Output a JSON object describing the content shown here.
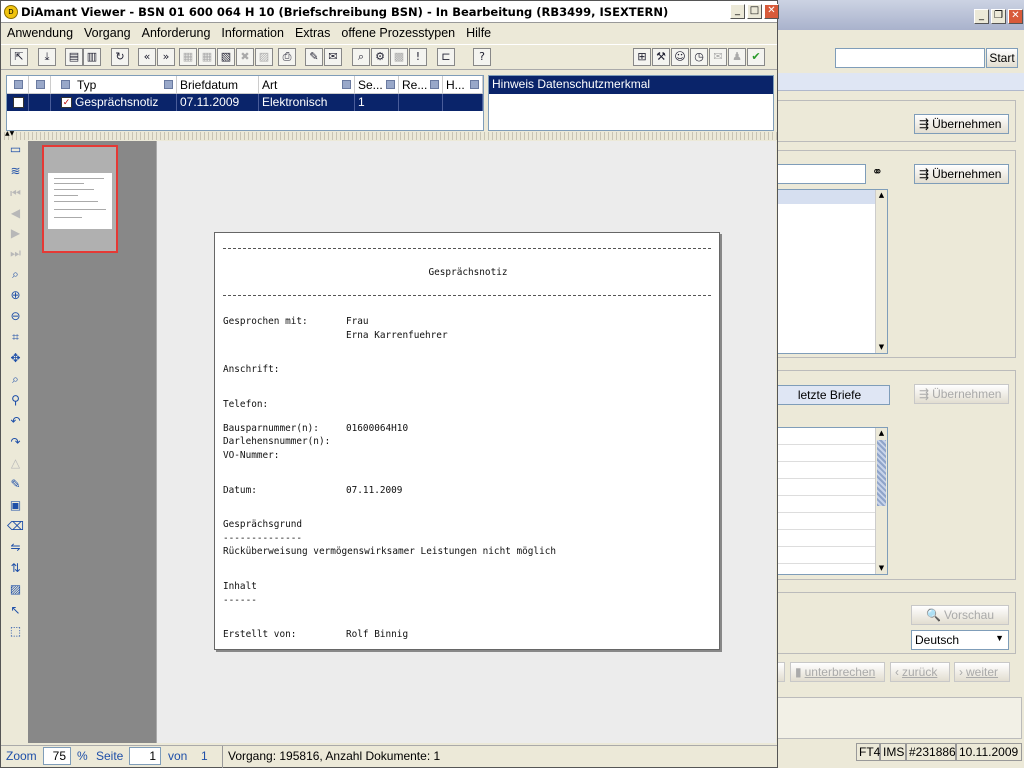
{
  "main_window": {
    "title": "DiAmant Viewer -  BSN 01 600 064 H 10 (Briefschreibung BSN) - In Bearbeitung (RB3499, ISEXTERN)",
    "menu": [
      "Anwendung",
      "Vorgang",
      "Anforderung",
      "Information",
      "Extras",
      "offene Prozesstypen",
      "Hilfe"
    ],
    "table": {
      "headers": [
        "Typ",
        "Briefdatum",
        "Art",
        "Se...",
        "Re...",
        "H..."
      ],
      "row": {
        "typ": "Gesprächsnotiz",
        "briefdatum": "07.11.2009",
        "art": "Elektronisch",
        "se": "1"
      }
    },
    "hinweis_header": "Hinweis Datenschutzmerkmal",
    "document": {
      "title": "Gesprächsnotiz",
      "gesprochen_label": "Gesprochen mit:",
      "gesprochen_value1": "Frau",
      "gesprochen_value2": "Erna Karrenfuehrer",
      "anschrift_label": "Anschrift:",
      "telefon_label": "Telefon:",
      "bauspar_label": "Bausparnummer(n):",
      "bauspar_value": "01600064H10",
      "darlehen_label": "Darlehensnummer(n):",
      "vo_label": "VO-Nummer:",
      "datum_label": "Datum:",
      "datum_value": "07.11.2009",
      "grund_label": "Gesprächsgrund",
      "grund_underline": "--------------",
      "grund_text": "Rücküberweisung vermögenswirksamer Leistungen nicht möglich",
      "inhalt_label": "Inhalt",
      "inhalt_underline": "------",
      "erstellt_label": "Erstellt von:",
      "erstellt_value": "Rolf Binnig"
    },
    "status": {
      "zoom_label": "Zoom",
      "zoom_value": "75",
      "percent": "%",
      "seite_label": "Seite",
      "seite_value": "1",
      "von_label": "von",
      "von_value": "1",
      "vorgang": "Vorgang: 195816, Anzahl Dokumente: 1"
    }
  },
  "background_window": {
    "start_button": "Start",
    "uebernehmen": "Übernehmen",
    "letzte_briefe": "letzte Briefe",
    "vorschau": "Vorschau",
    "language": "Deutsch",
    "unterbrechen": "unterbrechen",
    "zurueck": "zurück",
    "weiter": "weiter",
    "status": [
      "FT4",
      "IMS",
      "#231886",
      "10.11.2009"
    ]
  }
}
